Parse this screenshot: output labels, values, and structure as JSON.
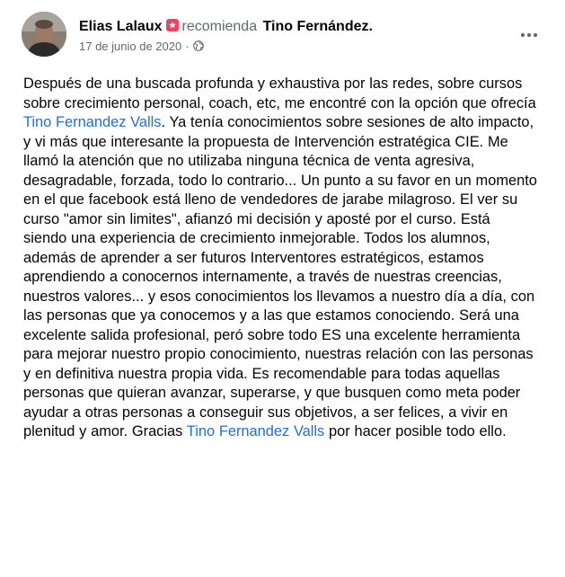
{
  "post": {
    "author": "Elias Lalaux",
    "action": "recomienda",
    "target": "Tino Fernández.",
    "date": "17 de junio de 2020",
    "dot": "·",
    "menu_icon": "ellipsis-icon",
    "privacy_icon": "globe-icon",
    "recommend_icon": "recommend-badge-icon",
    "colors": {
      "link": "#216fdb",
      "secondary": "#65676b",
      "badge": "#f3425f"
    },
    "text_part1": "Después de una buscada profunda y exhaustiva por las redes, sobre cursos sobre crecimiento personal, coach, etc, me encontré con la opción que ofrecía ",
    "link1": "Tino Fernandez Valls",
    "text_part2": ". Ya tenía conocimientos sobre sesiones de alto impacto, y vi más que interesante la propuesta de Intervención estratégica CIE. Me llamó la atención que no utilizaba ninguna técnica de venta agresiva, desagradable, forzada, todo lo contrario... Un punto a su favor en un momento en el que facebook está lleno de vendedores de jarabe milagroso. El ver su curso \"amor sin limites\", afianzó mi decisión y aposté por el curso. Está siendo una experiencia de crecimiento inmejorable. Todos los alumnos, además de aprender a ser futuros Interventores estratégicos, estamos aprendiendo a conocernos internamente, a través de nuestras creencias, nuestros valores... y esos conocimientos los llevamos a nuestro día a día, con las personas que ya conocemos y a las que estamos conociendo. Será una excelente salida profesional, peró sobre todo ES una excelente herramienta para mejorar nuestro propio conocimiento, nuestras relación con las personas y en definitiva nuestra propia vida. Es recomendable para todas aquellas personas que quieran avanzar, superarse, y que busquen como meta poder ayudar a otras personas a conseguir sus objetivos, a ser felices, a vivir en plenitud y amor. Gracias ",
    "link2": "Tino Fernandez Valls",
    "text_part3": " por hacer posible todo ello."
  }
}
